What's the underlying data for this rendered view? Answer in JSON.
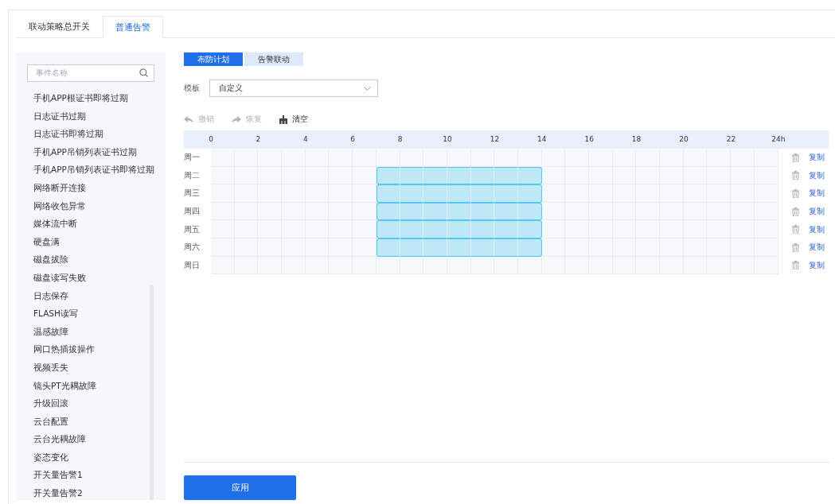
{
  "tabs": [
    {
      "label": "联动策略总开关",
      "selected": false
    },
    {
      "label": "普通告警",
      "selected": true
    }
  ],
  "sidebar": {
    "search": {
      "placeholder": "事件名称"
    },
    "items": [
      "手机APP根证书即将过期",
      "日志证书过期",
      "日志证书即将过期",
      "手机APP吊销列表证书过期",
      "手机APP吊销列表证书即将过期",
      "网络断开连接",
      "网络收包异常",
      "媒体流中断",
      "硬盘满",
      "磁盘拔除",
      "磁盘读写失败",
      "日志保存",
      "FLASH读写",
      "温感故障",
      "网口热插拔操作",
      "视频丢失",
      "镜头PT光耦故障",
      "升级回滚",
      "云台配置",
      "云台光耦故障",
      "姿态变化",
      "开关量告警1",
      "开关量告警2"
    ]
  },
  "subtabs": [
    {
      "label": "布防计划",
      "selected": true
    },
    {
      "label": "告警联动",
      "selected": false
    }
  ],
  "template": {
    "label": "模板",
    "value": "自定义"
  },
  "toolbar": [
    {
      "kind": "undo",
      "label": "撤销",
      "disabled": true
    },
    {
      "kind": "redo",
      "label": "恢复",
      "disabled": true
    },
    {
      "kind": "clear",
      "label": "清空",
      "disabled": false
    }
  ],
  "schedule": {
    "hour_labels": [
      "0",
      "2",
      "4",
      "6",
      "8",
      "10",
      "12",
      "14",
      "16",
      "18",
      "20",
      "22",
      "24h"
    ],
    "days": [
      {
        "label": "周一",
        "action": "复制",
        "hours": [
          false,
          false,
          false,
          false,
          false,
          false,
          false,
          false,
          false,
          false,
          false,
          false,
          false,
          false,
          false,
          false,
          false,
          false,
          false,
          false,
          false,
          false,
          false,
          false
        ]
      },
      {
        "label": "周二",
        "action": "复制",
        "hours": [
          false,
          false,
          false,
          false,
          false,
          false,
          false,
          true,
          true,
          true,
          true,
          true,
          true,
          true,
          false,
          false,
          false,
          false,
          false,
          false,
          false,
          false,
          false,
          false
        ]
      },
      {
        "label": "周三",
        "action": "复制",
        "hours": [
          false,
          false,
          false,
          false,
          false,
          false,
          false,
          true,
          true,
          true,
          true,
          true,
          true,
          true,
          false,
          false,
          false,
          false,
          false,
          false,
          false,
          false,
          false,
          false
        ]
      },
      {
        "label": "周四",
        "action": "复制",
        "hours": [
          false,
          false,
          false,
          false,
          false,
          false,
          false,
          true,
          true,
          true,
          true,
          true,
          true,
          true,
          false,
          false,
          false,
          false,
          false,
          false,
          false,
          false,
          false,
          false
        ]
      },
      {
        "label": "周五",
        "action": "复制",
        "hours": [
          false,
          false,
          false,
          false,
          false,
          false,
          false,
          true,
          true,
          true,
          true,
          true,
          true,
          true,
          false,
          false,
          false,
          false,
          false,
          false,
          false,
          false,
          false,
          false
        ]
      },
      {
        "label": "周六",
        "action": "复制",
        "hours": [
          false,
          false,
          false,
          false,
          false,
          false,
          false,
          true,
          true,
          true,
          true,
          true,
          true,
          true,
          false,
          false,
          false,
          false,
          false,
          false,
          false,
          false,
          false,
          false
        ]
      },
      {
        "label": "周日",
        "action": "复制",
        "hours": [
          false,
          false,
          false,
          false,
          false,
          false,
          false,
          false,
          false,
          false,
          false,
          false,
          false,
          false,
          false,
          false,
          false,
          false,
          false,
          false,
          false,
          false,
          false,
          false
        ]
      }
    ]
  },
  "apply_button": "应用"
}
